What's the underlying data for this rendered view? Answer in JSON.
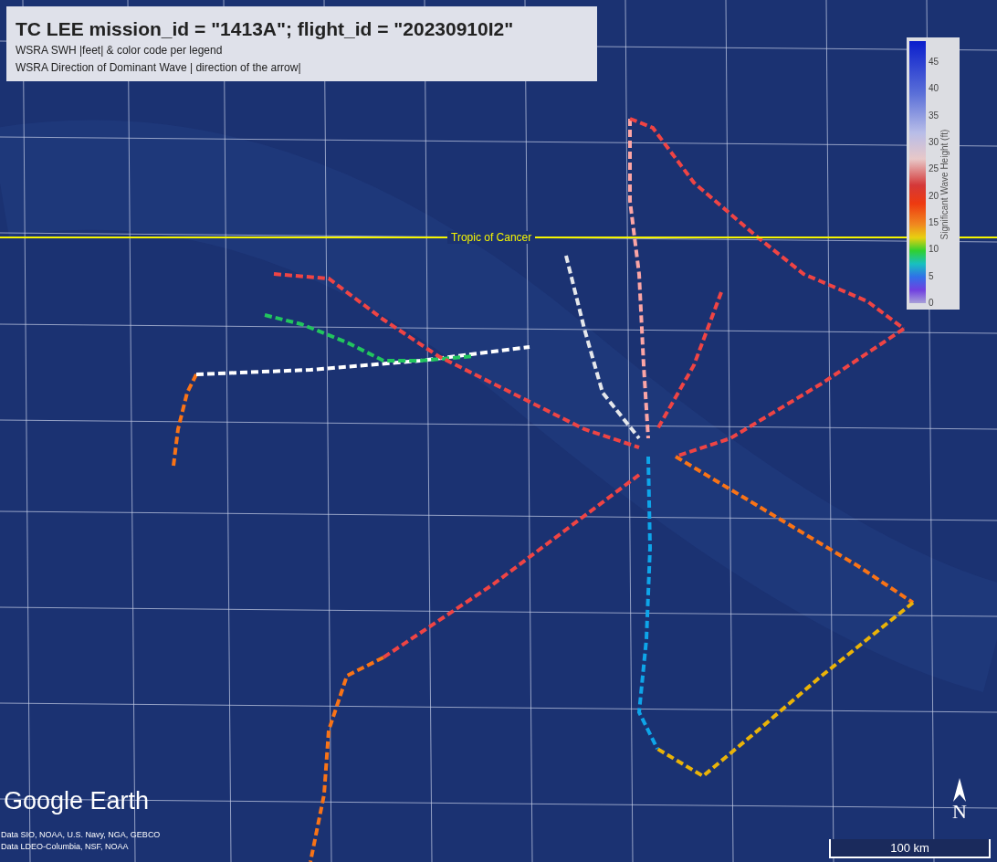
{
  "title_panel": {
    "title": "TC LEE mission_id = \"1413A\"; flight_id = \"20230910I2\"",
    "lines": [
      "WSRA SWH |feet| & color code per legend",
      "WSRA Direction of Dominant Wave | direction of the arrow|"
    ]
  },
  "map": {
    "line_label": "Tropic of Cancer"
  },
  "legend": {
    "title": "Significant Wave Height (ft)",
    "ticks": [
      "45",
      "40",
      "35",
      "30",
      "25",
      "20",
      "15",
      "10",
      "5",
      "0"
    ]
  },
  "logo": "Google Earth",
  "credits": [
    "Data SIO, NOAA, U.S. Navy, NGA, GEBCO",
    "Data LDEO-Columbia, NSF, NOAA"
  ],
  "compass": {
    "letter": "N"
  },
  "scale": {
    "label": "100 km"
  }
}
